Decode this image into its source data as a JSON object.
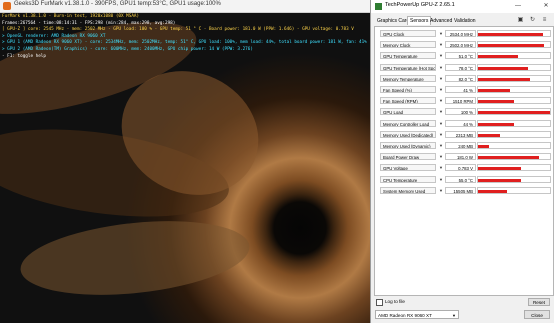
{
  "furmark": {
    "window_title": "Geeks3D FurMark v1.38.1.0 - 390FPS, GPU1 temp:53°C, GPU1 usage:100%",
    "hud": [
      "FurMark v1.38.1.0 - Burn-in test, 1920x1080 (0X MSAA)",
      "Frames:267564 - time:08:14:31 - FPS:298 (min:284, max:298, avg:298)",
      "[ GPU-Z ] core: 2545 MHz - mem: 2502 MHz - GPU load: 100 % - GPU temp: 51 ° C - Board power: 181.0 W (PPW: 1.646) - GPU voltage: 0.783 V",
      "> OpenGL renderer: AMD Radeon RX 9060 XT",
      "> GPU 1 (AMD Radeon RX 9060 XT) - core: 2534MHz, mem: 2502MHz, temp: 51° C, GPU load: 100%, mem load: 44%, total board power: 181 W, fan: 41%",
      "> GPU 2 (AMD Radeon(TM) Graphics) - core: 600MHz, mem: 2400MHz, GPU chip power: 14 W (PPW: 3.276)",
      "- F1: toggle help"
    ]
  },
  "gpuz": {
    "window_title": "TechPowerUp GPU-Z 2.65.1",
    "tabs": [
      "Graphics Card",
      "Sensors",
      "Advanced",
      "Validation"
    ],
    "active_tab": "Sensors",
    "sensors": [
      {
        "label": "GPU Clock",
        "value": "2534.0 MHz",
        "level": 0.9
      },
      {
        "label": "Memory Clock",
        "value": "2502.0 MHz",
        "level": 0.92
      },
      {
        "label": "GPU Temperature",
        "value": "51.0 °C",
        "level": 0.55
      },
      {
        "label": "GPU Temperature (Hot Spot)",
        "value": "78.0 °C",
        "level": 0.7
      },
      {
        "label": "Memory Temperature",
        "value": "82.0 °C",
        "level": 0.72
      },
      {
        "label": "Fan Speed (%)",
        "value": "41 %",
        "level": 0.45
      },
      {
        "label": "Fan Speed (RPM)",
        "value": "1510 RPM",
        "level": 0.5
      },
      {
        "label": "GPU Load",
        "value": "100 %",
        "level": 1.0
      },
      {
        "label": "Memory Controller Load",
        "value": "44 %",
        "level": 0.5
      },
      {
        "label": "Memory Used (Dedicated)",
        "value": "2313 MB",
        "level": 0.3
      },
      {
        "label": "Memory Used (Dynamic)",
        "value": "240 MB",
        "level": 0.15
      },
      {
        "label": "Board Power Draw",
        "value": "181.0 W",
        "level": 0.85
      },
      {
        "label": "GPU Voltage",
        "value": "0.783 V",
        "level": 0.6
      },
      {
        "label": "CPU Temperature",
        "value": "55.0 °C",
        "level": 0.6
      },
      {
        "label": "System Memory Used",
        "value": "15505 MB",
        "level": 0.4
      }
    ],
    "log_to_file": "Log to file",
    "reset_button": "Reset",
    "gpu_select": "AMD Radeon RX 9060 XT",
    "close_button": "Close",
    "colors": {
      "graph": "#e01f1f"
    }
  }
}
